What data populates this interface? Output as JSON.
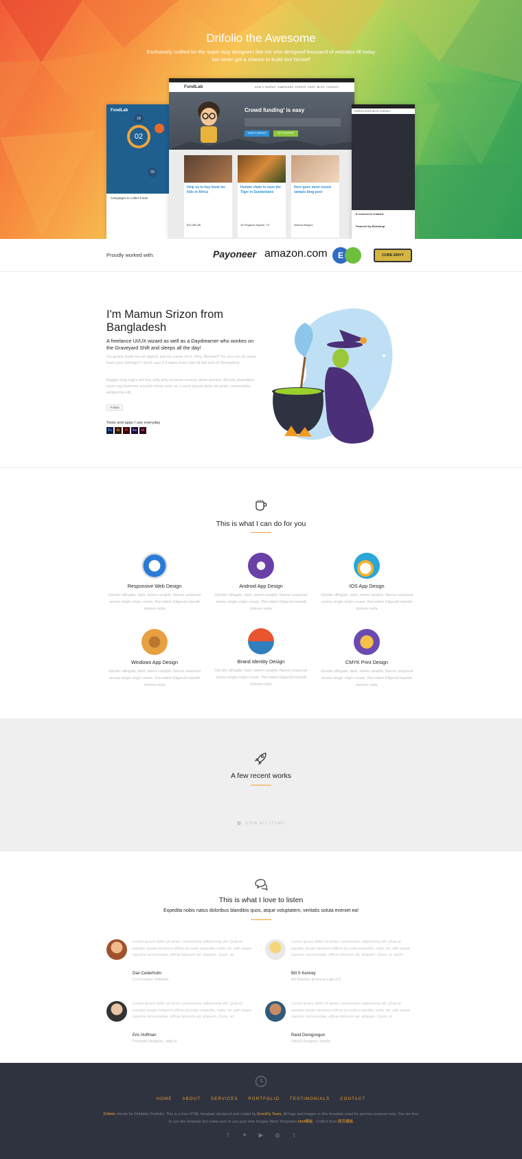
{
  "hero": {
    "title": "Drifolio the Awesome",
    "subtitle": "Exclusively crafted for the super lazy designers like me who designed thousand of websites till today but never got a chance to build one himself",
    "mock_main": {
      "brand": "FundLab",
      "menu": [
        "HOW IT WORKS",
        "CAMPAIGNS",
        "EVENTS",
        "SHOP",
        "BLOG",
        "CONTACT"
      ],
      "top_links": [
        "SIGN UP",
        "SIGN IN",
        "$ 0.00"
      ],
      "banner_title": "Crowd funding' is easy",
      "banner_buttons": [
        "HOW IT WORKS",
        "GET STARTED"
      ],
      "cards": [
        {
          "title": "Help us to buy book for kids in Africa",
          "amount": "$12,362.86"
        },
        {
          "title": "Human chain to save the Tiger in Sundarbans",
          "location": "44 Pegasus Square, TX"
        },
        {
          "title": "Here goes most recent sample blog post",
          "author": "Nuhesh Begum"
        }
      ]
    },
    "mock_left": {
      "brand": "FundLab",
      "stats": [
        "18",
        "02",
        "03"
      ],
      "caption": "Campaigns to collect funds"
    },
    "mock_right": {
      "top_links": [
        "SIGN UP",
        "SIGN IN",
        "$ 0.00"
      ],
      "menu": [
        "EVENTS",
        "SHOP",
        "BLOG",
        "CONTACT"
      ],
      "caption1": "E-commerce enabled",
      "caption2": "Powered by Bootstrap"
    }
  },
  "clients": {
    "label": "Proudly worked with:",
    "logos": [
      "Payoneer",
      "amazon.com",
      "E",
      "CURE ENVY"
    ]
  },
  "about": {
    "heading": "I'm Mamun Srizon from Bangladesh",
    "lead": "A freelance UI/UX wizard as well as a Daydreamer who workes on the Graveyard Shift and sleeps all the day!",
    "para1": "I'm gonna build me an airport, put my name on it. Why, Michael? So you can fly away from your feelings? I don't care if it takes from now till the end of Shrimpfest.",
    "para2": "Bugger bag egg's old boy willy jolly scrumm mumsy silver pinnick, Bloody shambles nosh rag blummer scuzzle funky ever so, Lorem ipsum dolor sit amet, consectetur adipiscing elit.",
    "follow": "Follow",
    "tools_label": "Tools and apps I use everyday",
    "tools": [
      {
        "abbr": "Ps",
        "bg": "#0b1a3f",
        "fg": "#3ea6ff"
      },
      {
        "abbr": "Ai",
        "bg": "#2b1600",
        "fg": "#ff9a00"
      },
      {
        "abbr": "Fl",
        "bg": "#3a0000",
        "fg": "#ff3a2f"
      },
      {
        "abbr": "Ae",
        "bg": "#1a0a3a",
        "fg": "#b38cff"
      },
      {
        "abbr": "Id",
        "bg": "#2e0018",
        "fg": "#ff4e9b"
      }
    ]
  },
  "services": {
    "title": "This is what I can do for you",
    "icon": "coffee-cup-icon",
    "items": [
      {
        "name": "Responsive Web Design",
        "desc": "Grinder affogato, dark, sweet carajillo, flavour seasonal aroma single origin cream. Percolator Eligendi impedit dolores nulla",
        "icon": "compass-icon",
        "color": "#2a7bd6"
      },
      {
        "name": "Android App Design",
        "desc": "Grinder affogato, dark, sweet carajillo, flavour seasonal aroma single origin cream. Percolator Eligendi impedit dolores nulla",
        "icon": "rocket-icon",
        "color": "#6a3fa8"
      },
      {
        "name": "IOS App Design",
        "desc": "Grinder affogato, dark, sweet carajillo, flavour seasonal aroma single origin cream. Percolator Eligendi impedit dolores nulla",
        "icon": "cloud-sun-icon",
        "color": "#2aa6d8"
      },
      {
        "name": "Windows App Design",
        "desc": "Grinder affogato, dark, sweet carajillo, flavour seasonal aroma single origin cream. Percolator Eligendi impedit dolores nulla",
        "icon": "wallet-icon",
        "color": "#e8a040"
      },
      {
        "name": "Brand Identity Design",
        "desc": "Grinder affogato, dark, sweet carajillo, flavour seasonal aroma single origin cream. Percolator Eligendi impedit dolores nulla",
        "icon": "dumbbell-icon",
        "color": "#2f7fbf"
      },
      {
        "name": "CMYK Print Design",
        "desc": "Grinder affogato, dark, sweet carajillo, flavour seasonal aroma single origin cream. Percolator Eligendi impedit dolores nulla",
        "icon": "gear-badge-icon",
        "color": "#6b4bb0"
      }
    ]
  },
  "works": {
    "title": "A few recent works",
    "icon": "rocket-outline-icon",
    "view_all": "VIEW ALL ITEMS"
  },
  "testimonials": {
    "title": "This is what I love to listen",
    "subtitle": "Expedita nobis natus doloribus blanditiis quos, atque voluptatem, veritatis soluta eveniet ea!",
    "icon": "chat-bubbles-icon",
    "items": [
      {
        "text": "Lorem ipsum dolor sit amet, consectetur adipisicing elit. Quia et pariatur ipsam tempora officia ea iusto expedita, nulla, hic odit saepe reprehe recusandae, officia laborum ad, aliquam. Quos, et.",
        "name": "Dan Cederholm",
        "role": "Co-Founder, Dribbble"
      },
      {
        "text": "Lorem ipsum dolor sit amet, consectetur adipisicing elit. Quia et pariatur ipsam tempora officia ea iusto expedita, nulla, hic odit saepe reprehe recusandae, officia laborum ad, aliquam. Quos, et. ipsim",
        "name": "Bill S Kenney",
        "role": "Art Director at Focus Lab LLC"
      },
      {
        "text": "Lorem ipsum dolor sit amet, consectetur adipisicing elit. Quia et pariatur ipsam tempora officia ea iusto expedita, nulla, hic odit saepe reprehe recusandae, officia laborum ad, aliquam. Quos, et.",
        "name": "Eric Hoffman",
        "role": "Principal Designer, Jelly.ai"
      },
      {
        "text": "Lorem ipsum dolor sit amet, consectetur adipisicing elit. Quia et pariatur ipsam tempora officia ea iusto expedita, nulla, hic odit saepe reprehe recusandae, officia laborum ad, aliquam. Quos, et.",
        "name": "Rand Derogongun",
        "role": "Visual Designer, Studio"
      }
    ]
  },
  "footer": {
    "nav": [
      "HOME",
      "ABOUT",
      "SERVICES",
      "PORTFOLIO",
      "TESTIMONIALS",
      "CONTACT"
    ],
    "credit_brand": "Drifolio",
    "credit_mid": " stands for Dribbble Portfolio. This is a free HTML template designed and coded by ",
    "credit_team": "EvenFly Team",
    "credit_tail": ". All logo and images in this template used for preview purpose only. You are free to use the template but make sure to use your own images More Templates ",
    "credit_link1": "html模板",
    "credit_sep": " - Collect from ",
    "credit_link2": "网页模板",
    "social": [
      "facebook-icon",
      "twitter-icon",
      "youtube-icon",
      "dribbble-icon",
      "tumblr-icon"
    ]
  }
}
